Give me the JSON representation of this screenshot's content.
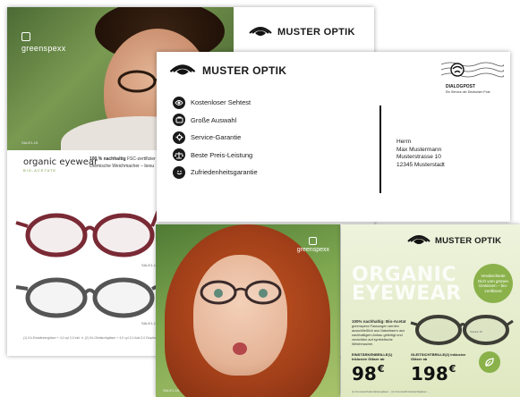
{
  "back_flyer": {
    "photo_logo": "greenspexx",
    "photo_code": "SALE1-15",
    "brand": "MUSTER OPTIK",
    "organic_logo": "organic eyewear",
    "organic_sub": "BIO-ACETATE",
    "organic_text_bold": "100 % nachhaltig",
    "organic_text_1": " FSC-zertifizier",
    "organic_text_2": "chemische Weichmacher – besu",
    "frame_code_1": "SALE1-15",
    "frame_code_2": "SALE1-15",
    "fineprint": "(1) Kö-Einstärkengläser + 4,0 cyl 2,0 inkl. h. (2) Kö-Gleitsichtgläser + 4,0 cyl 2,0 Add 3,0 Dioptrien"
  },
  "letter": {
    "brand": "MUSTER OPTIK",
    "benefits": [
      {
        "icon": "eye-icon",
        "label": "Kostenloser Sehtest"
      },
      {
        "icon": "glasses-case-icon",
        "label": "Große Auswahl"
      },
      {
        "icon": "wrench-icon",
        "label": "Service-Garantie"
      },
      {
        "icon": "scale-icon",
        "label": "Beste Preis-Leistung"
      },
      {
        "icon": "smile-icon",
        "label": "Zufriedenheitsgarantie"
      }
    ],
    "address": {
      "salutation": "Herrn",
      "name": "Max Mustermann",
      "street": "Musterstrasse 10",
      "city": "12345 Musterstadt"
    },
    "stamp_title": "DIALOGPOST",
    "stamp_sub": "Ein Service der Deutschen Post"
  },
  "front_photo": {
    "logo": "greenspexx",
    "code": "SALE1-15"
  },
  "promo": {
    "brand": "MUSTER OPTIK",
    "headline_1": "ORGANIC",
    "headline_2": "EYEWEAR",
    "bubble": "Verabschiede Dich vom grünen Gewissen – bio-zertifiziert",
    "copy_bold": "100% nachhaltig: Bio-Acetat",
    "copy_text": "greenspexx Fassungen werden ausschließlich aus Naturfasern aus nachhaltigem Anbau gefertigt und verzichten auf synthetische Weichmacher.",
    "model_code": "SALE1-15",
    "price_1_label": "EINSTÄRKENBRILLE(1) inklusive Gläser ab",
    "price_1_value": "98",
    "price_2_label": "GLEITSICHTBRILLE(2) inklusive Gläser ab",
    "price_2_value": "198",
    "currency": "€",
    "fineprint": "(1) Kunststoff-Einstärkengläser... (2) Kunststoff-Gleitsichtgläser ..."
  }
}
